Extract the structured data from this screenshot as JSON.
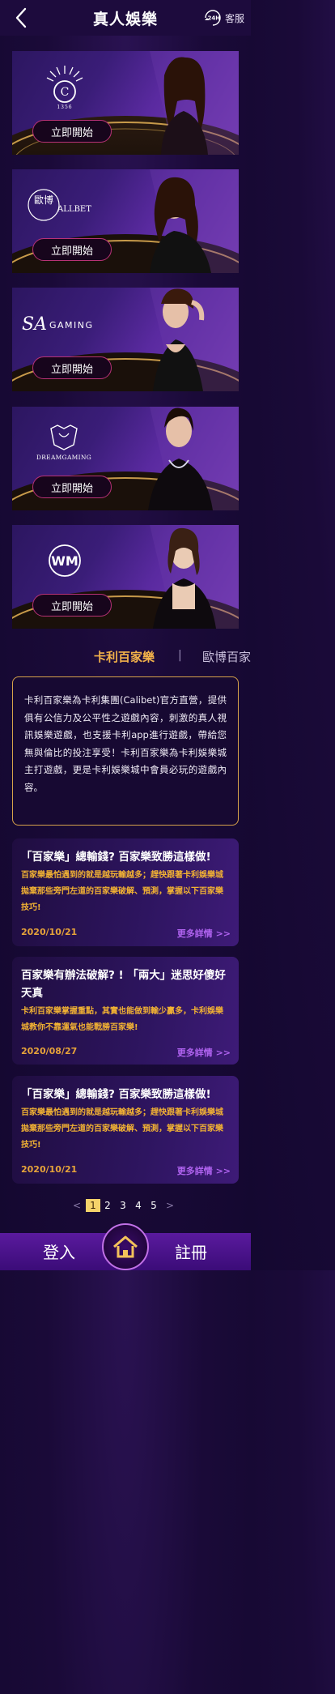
{
  "header": {
    "title": "真人娛樂",
    "cs_badge": "24H",
    "cs_label": "客服"
  },
  "games": [
    {
      "logo_text": "1356",
      "play_label": "立即開始"
    },
    {
      "logo_text": "歐博",
      "logo_sub": "ALLBET",
      "play_label": "立即開始"
    },
    {
      "logo_text": "SA",
      "logo_sub": "GAMING",
      "play_label": "立即開始"
    },
    {
      "logo_text": "DREAMGAMING",
      "play_label": "立即開始"
    },
    {
      "logo_text": "WM",
      "play_label": "立即開始"
    }
  ],
  "tabs": {
    "active": "卡利百家樂",
    "separator": "|",
    "inactive": "歐博百家"
  },
  "description": "卡利百家樂為卡利集團(Calibet)官方直營，提供俱有公信力及公平性之遊戲內容，刺激的真人視訊娛樂遊戲，也支援卡利app進行遊戲，帶給您無與倫比的投注享受！卡利百家樂為卡利娛樂城主打遊戲，更是卡利娛樂城中會員必玩的遊戲內容。",
  "articles": [
    {
      "title": "「百家樂」總輸錢? 百家樂致勝這樣做!",
      "body": "百家樂最怕遇到的就是越玩輸越多；趕快跟著卡利娛樂城拋棄那些旁門左道的百家樂破解、預測，掌握以下百家樂技巧!",
      "date": "2020/10/21",
      "more": "更多詳情 >>"
    },
    {
      "title": "百家樂有辦法破解? ! 「兩大」迷思好傻好天真",
      "body": "卡利百家樂掌握重點，其實也能做到輸少贏多，卡利娛樂城教你不靠運氣也能戰勝百家樂!",
      "date": "2020/08/27",
      "more": "更多詳情 >>"
    },
    {
      "title": "「百家樂」總輸錢? 百家樂致勝這樣做!",
      "body": "百家樂最怕遇到的就是越玩輸越多；趕快跟著卡利娛樂城拋棄那些旁門左道的百家樂破解、預測，掌握以下百家樂技巧!",
      "date": "2020/10/21",
      "more": "更多詳情 >>"
    }
  ],
  "pagination": {
    "prev": "<",
    "pages": [
      "1",
      "2",
      "3",
      "4",
      "5"
    ],
    "current": "1",
    "next": ">"
  },
  "bottom_nav": {
    "login": "登入",
    "register": "註冊"
  },
  "colors": {
    "accent_gold": "#f3b24a",
    "play_border": "#b83276",
    "more_link": "#b063f0",
    "bottom_bar": "#5a1a9e"
  }
}
